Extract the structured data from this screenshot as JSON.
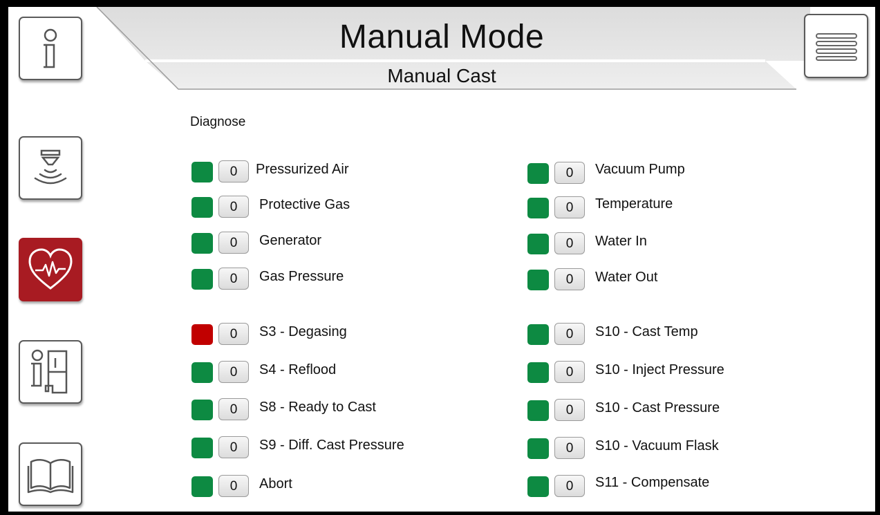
{
  "header": {
    "title": "Manual Mode",
    "subtitle": "Manual Cast"
  },
  "section": {
    "label": "Diagnose"
  },
  "colors": {
    "ok": "#0d8a42",
    "error": "#c10000",
    "active_nav": "#a81b22"
  },
  "sidebar": {
    "items": [
      {
        "icon": "info-icon",
        "active": false
      },
      {
        "icon": "sensor-icon",
        "active": false
      },
      {
        "icon": "heart-pulse-icon",
        "active": true
      },
      {
        "icon": "machine-info-icon",
        "active": false
      },
      {
        "icon": "book-icon",
        "active": false
      }
    ]
  },
  "menu": {
    "icon": "hamburger-menu-icon"
  },
  "diagnostics": {
    "left": [
      {
        "status": "ok",
        "count": "0",
        "label": "Pressurized Air"
      },
      {
        "status": "ok",
        "count": "0",
        "label": "Protective Gas"
      },
      {
        "status": "ok",
        "count": "0",
        "label": "Generator"
      },
      {
        "status": "ok",
        "count": "0",
        "label": "Gas Pressure"
      },
      {
        "status": "error",
        "count": "0",
        "label": "S3 - Degasing"
      },
      {
        "status": "ok",
        "count": "0",
        "label": "S4 - Reflood"
      },
      {
        "status": "ok",
        "count": "0",
        "label": "S8 - Ready to Cast"
      },
      {
        "status": "ok",
        "count": "0",
        "label": "S9 - Diff. Cast Pressure"
      },
      {
        "status": "ok",
        "count": "0",
        "label": "Abort"
      }
    ],
    "right": [
      {
        "status": "ok",
        "count": "0",
        "label": "Vacuum Pump"
      },
      {
        "status": "ok",
        "count": "0",
        "label": "Temperature"
      },
      {
        "status": "ok",
        "count": "0",
        "label": "Water In"
      },
      {
        "status": "ok",
        "count": "0",
        "label": "Water Out"
      },
      {
        "status": "ok",
        "count": "0",
        "label": "S10 - Cast Temp"
      },
      {
        "status": "ok",
        "count": "0",
        "label": "S10 - Inject Pressure"
      },
      {
        "status": "ok",
        "count": "0",
        "label": "S10 - Cast Pressure"
      },
      {
        "status": "ok",
        "count": "0",
        "label": "S10 - Vacuum Flask"
      },
      {
        "status": "ok",
        "count": "0",
        "label": "S11 - Compensate"
      }
    ]
  }
}
